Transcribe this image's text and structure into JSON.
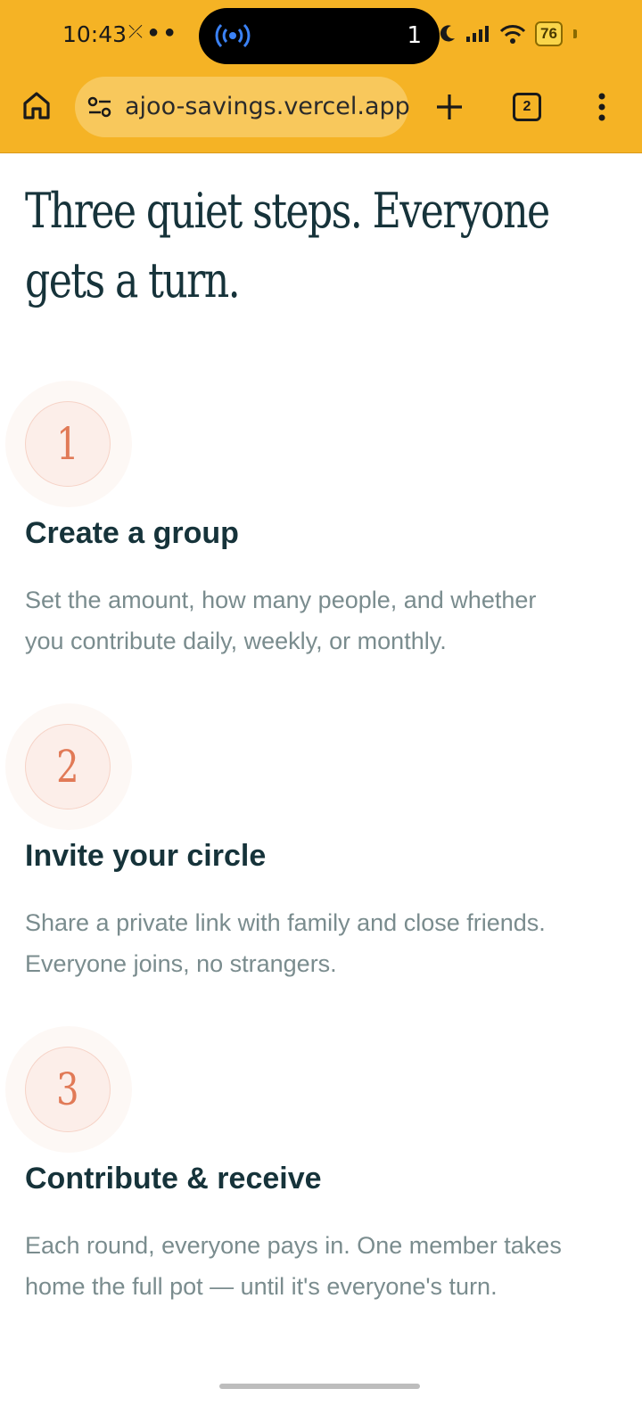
{
  "status_bar": {
    "time": "10:43",
    "island_count": "1",
    "battery": "76"
  },
  "browser": {
    "url": "ajoo-savings.vercel.app",
    "tab_count": "2",
    "colors": {
      "toolbar": "#F5B325",
      "urlbar": "#F8C85C"
    }
  },
  "page": {
    "heading_line1": "Three quiet steps. Everyone",
    "heading_line2": "gets a turn.",
    "steps": [
      {
        "number": "1",
        "title": "Create a group",
        "desc_line1": "Set the amount, how many people, and whether",
        "desc_line2": "you contribute daily, weekly, or monthly."
      },
      {
        "number": "2",
        "title": "Invite your circle",
        "desc_line1": "Share a private link with family and close friends.",
        "desc_line2": "Everyone joins, no strangers."
      },
      {
        "number": "3",
        "title": "Contribute & receive",
        "desc_line1": "Each round, everyone pays in. One member takes",
        "desc_line2": "home the full pot — until it's everyone's turn."
      }
    ],
    "colors": {
      "heading": "#16333A",
      "accent": "#E17A57",
      "muted": "#7A8C8E"
    }
  }
}
